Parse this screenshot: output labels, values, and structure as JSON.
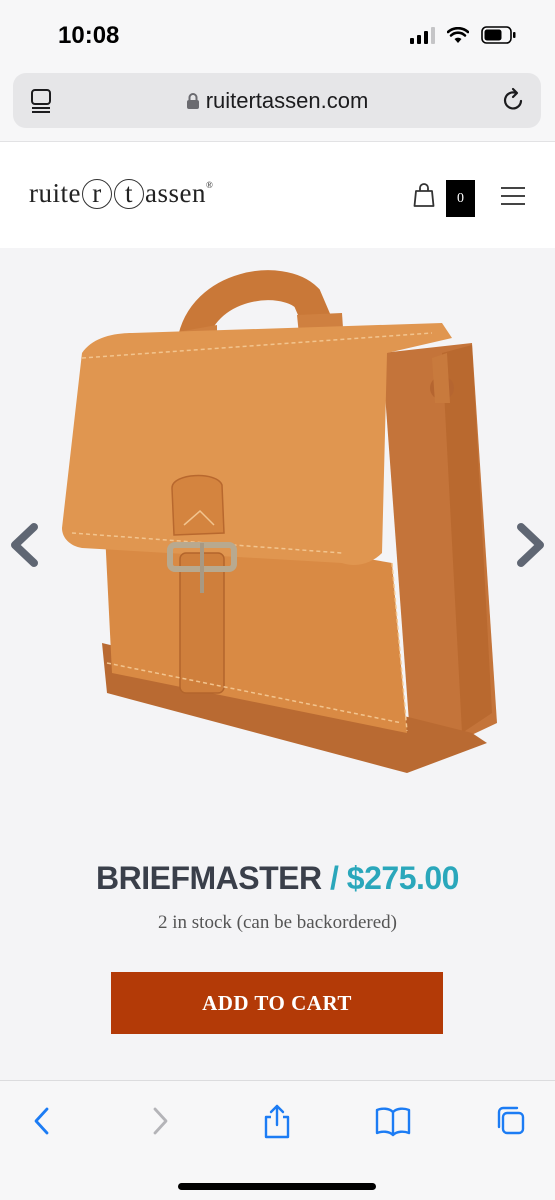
{
  "status_bar": {
    "time": "10:08"
  },
  "browser": {
    "url": "ruitertassen.com"
  },
  "header": {
    "logo_text_before": "ruite",
    "logo_ring_1": "r",
    "logo_ring_2": "t",
    "logo_text_after": "assen",
    "logo_mark": "®",
    "cart_count": "0"
  },
  "product": {
    "name": "BRIEFMASTER",
    "separator": "/",
    "price": "$275.00",
    "stock": "2 in stock (can be backordered)",
    "cta": "ADD TO CART"
  },
  "colors": {
    "accent": "#2aa7bb",
    "cta_background": "#b33a07",
    "leather": "#d98a44",
    "ios_blue": "#1c7cf4"
  },
  "icons": {
    "tabs": "tab-overview-icon",
    "lock": "lock-icon",
    "reload": "reload-icon",
    "cart": "shopping-bag-icon",
    "menu": "hamburger-menu-icon",
    "prev": "chevron-left-icon",
    "next": "chevron-right-icon",
    "back": "back-icon",
    "forward": "forward-icon",
    "share": "share-icon",
    "bookmarks": "bookmarks-icon",
    "pages": "tabs-icon"
  }
}
